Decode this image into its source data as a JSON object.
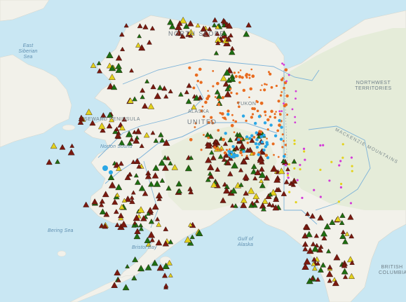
{
  "map": {
    "labels": {
      "north_slope": "NORTH SLOPE",
      "east_siberian_sea": "East\nSiberian\nSea",
      "northwest_territories": "NORTHWEST\nTERRITORIES",
      "seward_peninsula": "SEWARD PENINSULA",
      "norton_sound": "Norton Sound",
      "united": "UNITED",
      "alaska": "ALASKA",
      "yukon": "YUKON",
      "mackenzie_mountains": "MACKENZIE MOUNTAINS",
      "bering_sea": "Bering Sea",
      "bristol_bay": "Bristol Bay",
      "gulf_of_alaska": "Gulf of\nAlaska",
      "british_columbia": "BRITISH\nCOLUMBIA"
    },
    "colors": {
      "water": "#c9e7f3",
      "land": "#f2f1ea",
      "land_green": "#e3ecd6",
      "boundary": "#7db3d9",
      "marker_dark_red": "#7a1a10",
      "marker_green": "#1d6e12",
      "marker_yellow": "#e3d21c",
      "marker_orange": "#e86b1f",
      "marker_blue": "#2aa7e6",
      "marker_magenta": "#d43ad8"
    }
  }
}
